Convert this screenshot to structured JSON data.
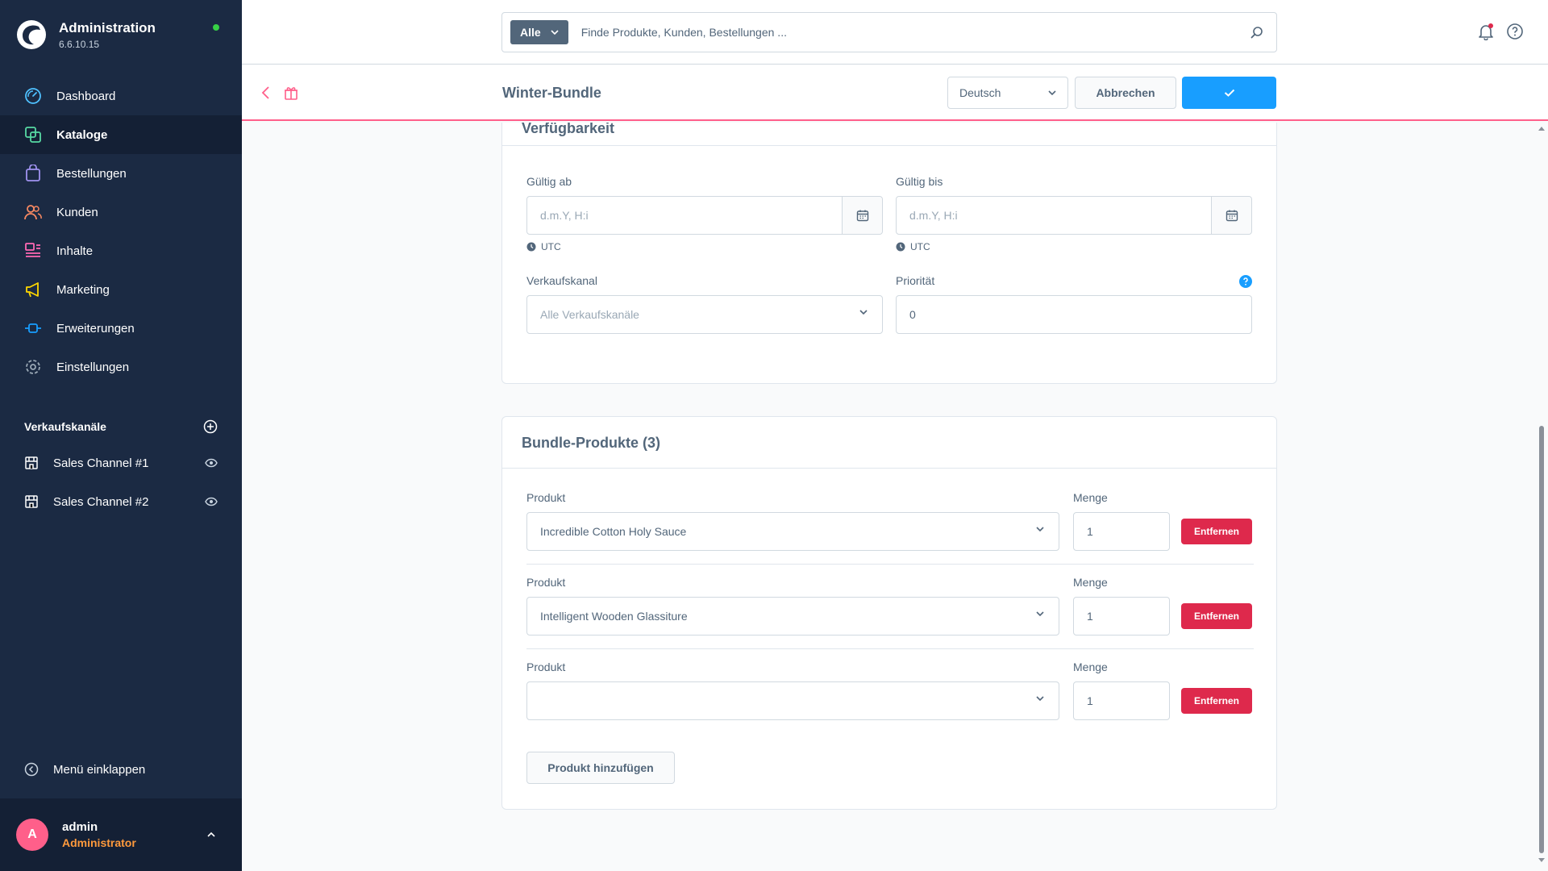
{
  "app": {
    "title": "Administration",
    "version": "6.6.10.15"
  },
  "colors": {
    "sidebar": "#1b2a43",
    "accent": "#189eff",
    "danger": "#de294c",
    "highlight": "#ff5f8a",
    "status": "#37d046"
  },
  "nav": [
    {
      "label": "Dashboard",
      "icon": "dashboard-icon",
      "color": "#4fc1ff"
    },
    {
      "label": "Kataloge",
      "icon": "catalog-icon",
      "color": "#57d9a3",
      "active": true
    },
    {
      "label": "Bestellungen",
      "icon": "orders-icon",
      "color": "#a092f0"
    },
    {
      "label": "Kunden",
      "icon": "customers-icon",
      "color": "#f88962"
    },
    {
      "label": "Inhalte",
      "icon": "content-icon",
      "color": "#ff68b4"
    },
    {
      "label": "Marketing",
      "icon": "marketing-icon",
      "color": "#ffd700"
    },
    {
      "label": "Erweiterungen",
      "icon": "extensions-icon",
      "color": "#189eff"
    },
    {
      "label": "Einstellungen",
      "icon": "settings-icon",
      "color": "#9aa8b5"
    }
  ],
  "sales_channels": {
    "heading": "Verkaufskanäle",
    "items": [
      {
        "label": "Sales Channel #1"
      },
      {
        "label": "Sales Channel #2"
      }
    ]
  },
  "collapse_label": "Menü einklappen",
  "user": {
    "initial": "A",
    "name": "admin",
    "role": "Administrator"
  },
  "search": {
    "type_label": "Alle",
    "placeholder": "Finde Produkte, Kunden, Bestellungen ..."
  },
  "smartbar": {
    "title": "Winter-Bundle",
    "language": "Deutsch",
    "cancel_label": "Abbrechen"
  },
  "availability": {
    "title": "Verfügbarkeit",
    "valid_from_label": "Gültig ab",
    "valid_until_label": "Gültig bis",
    "date_placeholder": "d.m.Y, H:i",
    "timezone": "UTC",
    "channel_label": "Verkaufskanal",
    "channel_placeholder": "Alle Verkaufskanäle",
    "priority_label": "Priorität",
    "priority_value": "0"
  },
  "bundle": {
    "title": "Bundle-Produkte (3)",
    "product_label": "Produkt",
    "quantity_label": "Menge",
    "remove_label": "Entfernen",
    "add_label": "Produkt hinzufügen",
    "rows": [
      {
        "product": "Incredible Cotton Holy Sauce",
        "quantity": "1"
      },
      {
        "product": "Intelligent Wooden Glassiture",
        "quantity": "1"
      },
      {
        "product": "",
        "quantity": "1"
      }
    ]
  }
}
